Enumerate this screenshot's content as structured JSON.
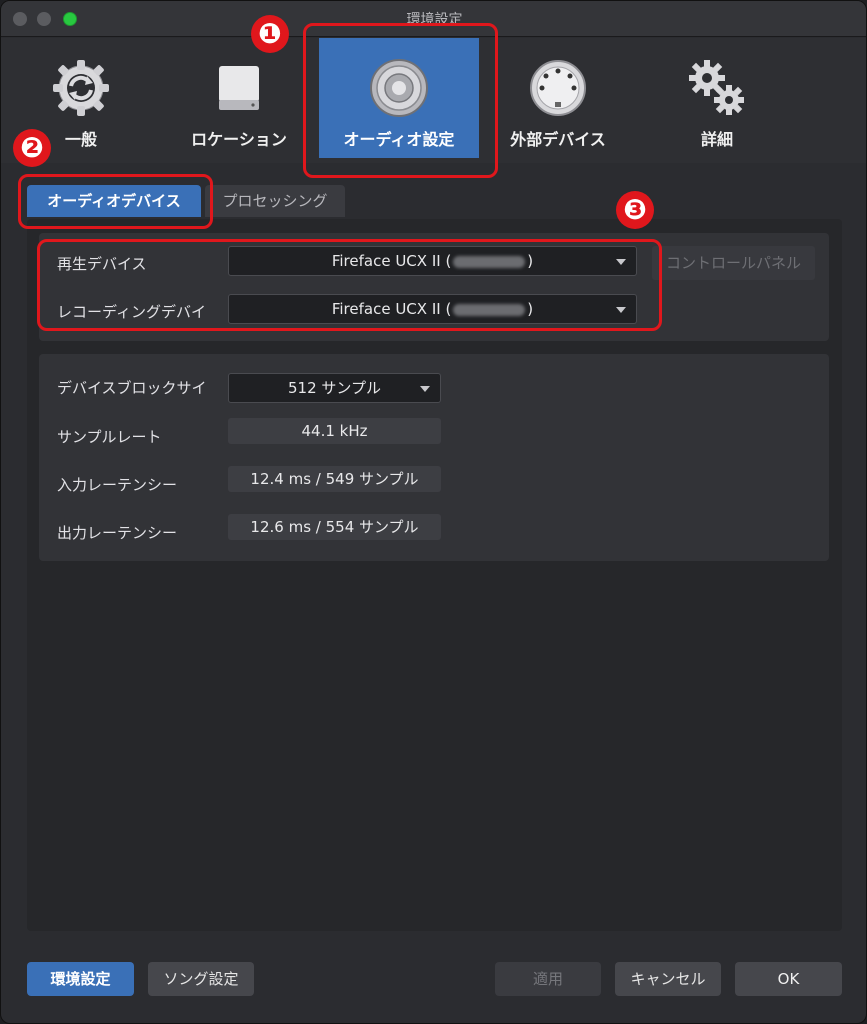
{
  "window": {
    "title": "環境設定"
  },
  "toolbar": {
    "items": [
      {
        "label": "一般",
        "icon": "sync-gear-icon"
      },
      {
        "label": "ロケーション",
        "icon": "drive-icon"
      },
      {
        "label": "オーディオ設定",
        "icon": "speaker-icon",
        "active": true
      },
      {
        "label": "外部デバイス",
        "icon": "midi-connector-icon"
      },
      {
        "label": "詳細",
        "icon": "gears-icon"
      }
    ]
  },
  "annotations": {
    "badge1": "❶",
    "badge2": "❷",
    "badge3": "❸"
  },
  "tabs": {
    "audio_device": "オーディオデバイス",
    "processing": "プロセッシング"
  },
  "device": {
    "playback_label": "再生デバイス",
    "playback_value_prefix": "Fireface UCX II (",
    "playback_value_suffix": ")",
    "recording_label": "レコーディングデバイ",
    "recording_value_prefix": "Fireface UCX II (",
    "recording_value_suffix": ")",
    "control_panel": "コントロールパネル"
  },
  "settings": {
    "block_size_label": "デバイスブロックサイ",
    "block_size_value": "512 サンプル",
    "sample_rate_label": "サンプルレート",
    "sample_rate_value": "44.1 kHz",
    "input_latency_label": "入力レーテンシー",
    "input_latency_value": "12.4 ms / 549 サンプル",
    "output_latency_label": "出力レーテンシー",
    "output_latency_value": "12.6 ms / 554 サンプル"
  },
  "footer": {
    "env_settings": "環境設定",
    "song_settings": "ソング設定",
    "apply": "適用",
    "cancel": "キャンセル",
    "ok": "OK"
  },
  "colors": {
    "accent": "#3a70b7",
    "annotation": "#e0171c"
  }
}
